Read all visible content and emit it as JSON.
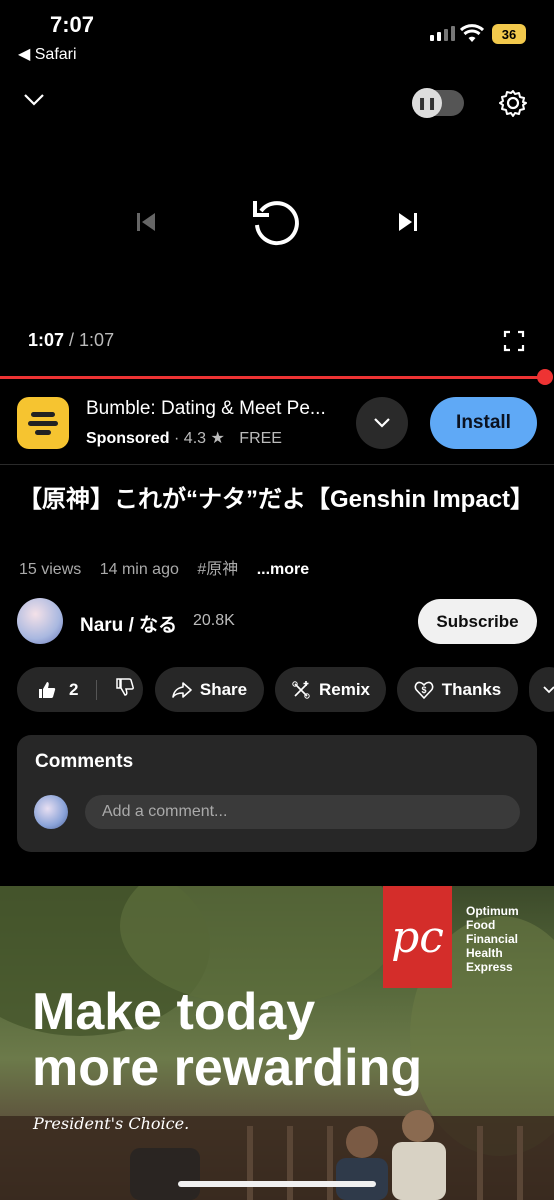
{
  "status": {
    "time": "7:07",
    "back_app": "◀ Safari",
    "battery": "36"
  },
  "player": {
    "current_time": "1:07",
    "duration": "/ 1:07",
    "progress": 1.0
  },
  "ad": {
    "title": "Bumble: Dating & Meet Pe...",
    "sponsored": "Sponsored",
    "rating": "4.3",
    "price": "FREE",
    "install_label": "Install"
  },
  "video": {
    "title": "【原神】これが“ナタ”だよ【Genshin Impact】",
    "views": "15 views",
    "age": "14 min ago",
    "hashtag": "#原神",
    "more": "...more"
  },
  "channel": {
    "name": "Naru / なる",
    "subscribers": "20.8K",
    "subscribe_label": "Subscribe"
  },
  "actions": {
    "likes": "2",
    "share": "Share",
    "remix": "Remix",
    "thanks": "Thanks"
  },
  "comments": {
    "title": "Comments",
    "placeholder": "Add a comment..."
  },
  "banner": {
    "brands": [
      "Optimum",
      "Food",
      "Financial",
      "Health",
      "Express"
    ],
    "headline_line1": "Make today",
    "headline_line2": "more rewarding",
    "tagline": "President's Choice."
  },
  "colors": {
    "accent_red": "#e33333",
    "install_blue": "#5fa9f6",
    "pill_bg": "#272727"
  }
}
